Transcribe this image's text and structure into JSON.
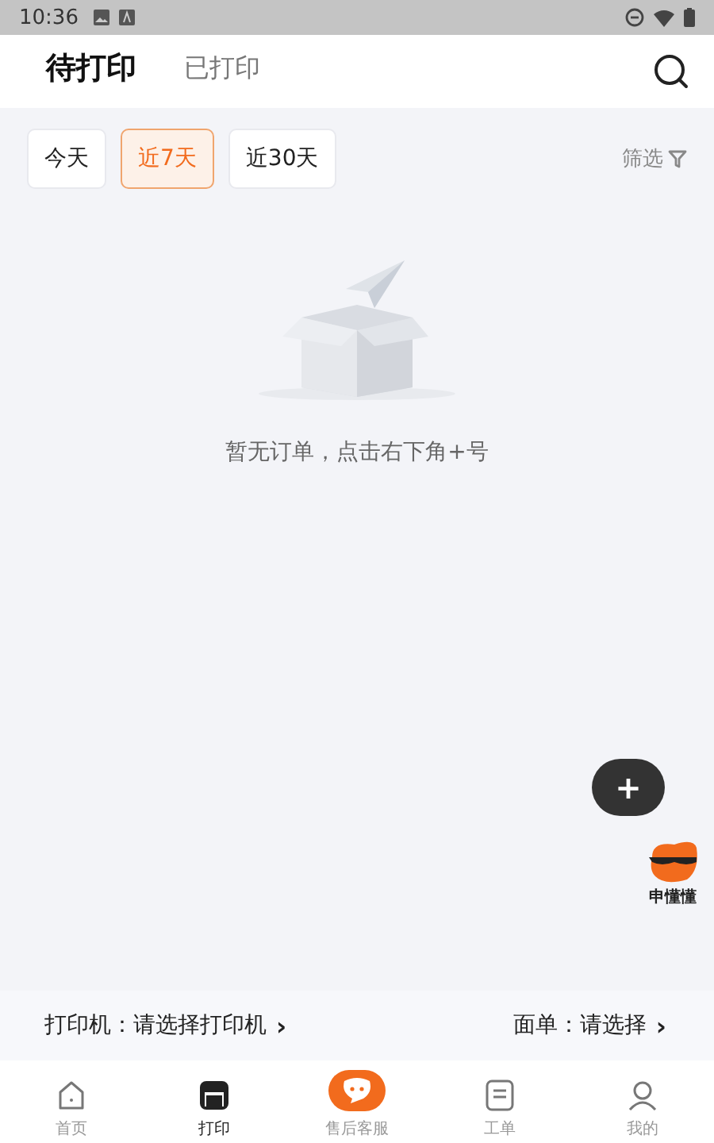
{
  "status_bar": {
    "time": "10:36"
  },
  "tabs": [
    {
      "label": "待打印",
      "selected": true
    },
    {
      "label": "已打印",
      "selected": false
    }
  ],
  "date_filters": [
    {
      "label": "今天",
      "selected": false
    },
    {
      "label": "近7天",
      "selected": true
    },
    {
      "label": "近30天",
      "selected": false
    }
  ],
  "filter_label": "筛选",
  "empty_state": {
    "message": "暂无订单，点击右下角+号"
  },
  "fab": {
    "label": "+"
  },
  "mascot": {
    "label": "申懂懂"
  },
  "settings_bar": {
    "printer": "打印机：请选择打印机",
    "printer_arrow": "›",
    "waybill": "面单：请选择",
    "waybill_arrow": "›"
  },
  "nav": [
    {
      "kind": "home",
      "label": "首页",
      "selected": false
    },
    {
      "kind": "print",
      "label": "打印",
      "selected": true
    },
    {
      "kind": "service",
      "label": "售后客服",
      "selected": false
    },
    {
      "kind": "orders",
      "label": "工单",
      "selected": false
    },
    {
      "kind": "me",
      "label": "我的",
      "selected": false
    }
  ]
}
